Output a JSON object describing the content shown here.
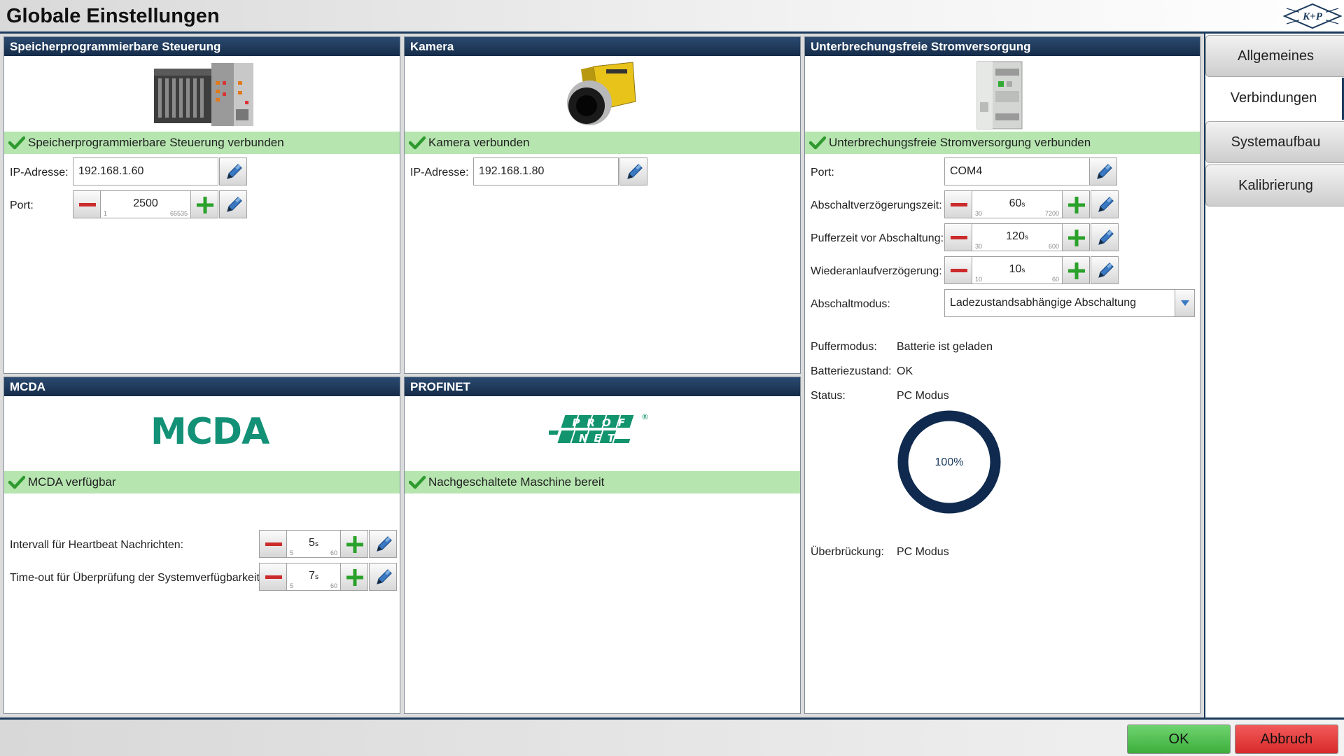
{
  "header": {
    "title": "Globale Einstellungen",
    "logo_text": "K+P"
  },
  "plc": {
    "title": "Speicherprogrammierbare Steuerung",
    "status": "Speicherprogrammierbare Steuerung verbunden",
    "ip_label": "IP-Adresse:",
    "ip_value": "192.168.1.60",
    "port_label": "Port:",
    "port": {
      "value": "2500",
      "unit": "",
      "min": "1",
      "max": "65535"
    }
  },
  "camera": {
    "title": "Kamera",
    "status": "Kamera verbunden",
    "ip_label": "IP-Adresse:",
    "ip_value": "192.168.1.80"
  },
  "ups": {
    "title": "Unterbrechungsfreie Stromversorgung",
    "status": "Unterbrechungsfreie Stromversorgung verbunden",
    "port_label": "Port:",
    "port_value": "COM4",
    "shutdown_delay": {
      "label": "Abschaltverzögerungszeit:",
      "value": "60",
      "unit": "s",
      "min": "30",
      "max": "7200"
    },
    "buffer_time": {
      "label": "Pufferzeit vor Abschaltung:",
      "value": "120",
      "unit": "s",
      "min": "30",
      "max": "600"
    },
    "restart_delay": {
      "label": "Wiederanlaufverzögerung:",
      "value": "10",
      "unit": "s",
      "min": "10",
      "max": "60"
    },
    "mode_label": "Abschaltmodus:",
    "mode_value": "Ladezustandsabhängige Abschaltung",
    "buffer_mode_label": "Puffermodus:",
    "buffer_mode_value": "Batterie ist geladen",
    "battery_label": "Batteriezustand:",
    "battery_value": "OK",
    "status_label": "Status:",
    "status_value": "PC Modus",
    "charge_text": "100%",
    "charge_fraction": 1.0,
    "bridging_label": "Überbrückung:",
    "bridging_value": "PC Modus"
  },
  "mcda": {
    "title": "MCDA",
    "logo_text": "MCDA",
    "status": "MCDA verfügbar",
    "heartbeat": {
      "label": "Intervall für Heartbeat Nachrichten:",
      "value": "5",
      "unit": "s",
      "min": "5",
      "max": "60"
    },
    "timeout": {
      "label": "Time-out für Überprüfung der Systemverfügbarkeit:",
      "value": "7",
      "unit": "s",
      "min": "5",
      "max": "60"
    }
  },
  "profinet": {
    "title": "PROFINET",
    "logo_top": "PROFI",
    "logo_bottom": "NET",
    "logo_mark": "®",
    "status": "Nachgeschaltete Maschine bereit"
  },
  "tabs": [
    {
      "label": "Allgemeines",
      "active": false
    },
    {
      "label": "Verbindungen",
      "active": true
    },
    {
      "label": "Systemaufbau",
      "active": false
    },
    {
      "label": "Kalibrierung",
      "active": false
    }
  ],
  "footer": {
    "ok_label": "OK",
    "cancel_label": "Abbruch"
  },
  "colors": {
    "accent": "#1b3a5c",
    "status_ok": "#b6e5b0",
    "check": "#2f9a2f",
    "plus": "#2aa12a",
    "minus": "#cc2b2b",
    "mcda_green": "#139177",
    "ok_button": "#4cbf4c",
    "cancel_button": "#e03a3a"
  }
}
